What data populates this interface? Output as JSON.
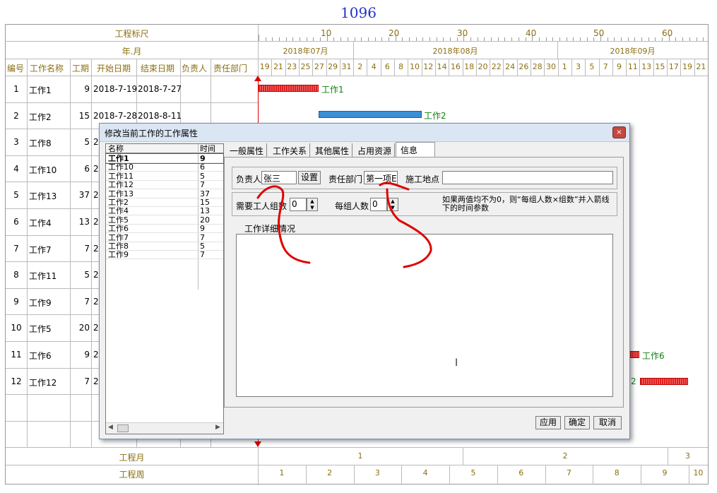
{
  "title": "1096",
  "header": {
    "ruler_label": "工程标尺",
    "month_label": "年.月",
    "ruler_ticks": [
      "10",
      "20",
      "30",
      "40",
      "50",
      "60"
    ],
    "months": [
      "2018年07月",
      "2018年08月",
      "2018年09月"
    ],
    "columns": {
      "no": "编号",
      "name": "工作名称",
      "duration": "工期",
      "start": "开始日期",
      "end": "结束日期",
      "owner": "负责人",
      "dept": "责任部门"
    },
    "days": [
      "19",
      "21",
      "23",
      "25",
      "27",
      "29",
      "31",
      "2",
      "4",
      "6",
      "8",
      "10",
      "12",
      "14",
      "16",
      "18",
      "20",
      "22",
      "24",
      "26",
      "28",
      "30",
      "1",
      "3",
      "5",
      "7",
      "9",
      "11",
      "13",
      "15",
      "17",
      "19",
      "21"
    ]
  },
  "rows": [
    {
      "no": "1",
      "name": "工作1",
      "dur": "9",
      "start": "2018-7-19",
      "end": "2018-7-27"
    },
    {
      "no": "2",
      "name": "工作2",
      "dur": "15",
      "start": "2018-7-28",
      "end": "2018-8-11"
    },
    {
      "no": "3",
      "name": "工作8",
      "dur": "5",
      "start": "2",
      "end": ""
    },
    {
      "no": "4",
      "name": "工作10",
      "dur": "6",
      "start": "2",
      "end": ""
    },
    {
      "no": "5",
      "name": "工作13",
      "dur": "37",
      "start": "2",
      "end": ""
    },
    {
      "no": "6",
      "name": "工作4",
      "dur": "13",
      "start": "2",
      "end": ""
    },
    {
      "no": "7",
      "name": "工作7",
      "dur": "7",
      "start": "2",
      "end": ""
    },
    {
      "no": "8",
      "name": "工作11",
      "dur": "5",
      "start": "2",
      "end": ""
    },
    {
      "no": "9",
      "name": "工作9",
      "dur": "7",
      "start": "2",
      "end": ""
    },
    {
      "no": "10",
      "name": "工作5",
      "dur": "20",
      "start": "2",
      "end": ""
    },
    {
      "no": "11",
      "name": "工作6",
      "dur": "9",
      "start": "2",
      "end": ""
    },
    {
      "no": "12",
      "name": "工作12",
      "dur": "7",
      "start": "2",
      "end": ""
    }
  ],
  "gantt_labels": {
    "r1": "工作1",
    "r2": "工作2",
    "r11": "工作6",
    "r12": "2"
  },
  "footer": {
    "month_label": "工程月",
    "week_label": "工程周",
    "months": [
      "1",
      "2",
      "3"
    ],
    "weeks": [
      "1",
      "2",
      "3",
      "4",
      "5",
      "6",
      "7",
      "8",
      "9",
      "10"
    ]
  },
  "dialog": {
    "title": "修改当前工作的工作属性",
    "close": "×",
    "list_headers": {
      "name": "名称",
      "time": "时间"
    },
    "list": [
      {
        "name": "工作1",
        "time": "9"
      },
      {
        "name": "工作10",
        "time": "6"
      },
      {
        "name": "工作11",
        "time": "5"
      },
      {
        "name": "工作12",
        "time": "7"
      },
      {
        "name": "工作13",
        "time": "37"
      },
      {
        "name": "工作2",
        "time": "15"
      },
      {
        "name": "工作4",
        "time": "13"
      },
      {
        "name": "工作5",
        "time": "20"
      },
      {
        "name": "工作6",
        "time": "9"
      },
      {
        "name": "工作7",
        "time": "7"
      },
      {
        "name": "工作8",
        "time": "5"
      },
      {
        "name": "工作9",
        "time": "7"
      }
    ],
    "tabs": [
      "一般属性",
      "工作关系",
      "其他属性",
      "占用资源",
      "信息"
    ],
    "owner_label": "负责人",
    "owner_value": "张三",
    "set_button": "设置",
    "dept_label": "责任部门",
    "dept_value": "第一项E",
    "site_label": "施工地点",
    "site_value": "",
    "groups_label": "需要工人组数",
    "groups_value": "0",
    "per_group_label": "每组人数",
    "per_group_value": "0",
    "note": "如果两值均不为0，则“每组人数×组数”并入箭线下的时间参数",
    "details_label": "工作详细情况",
    "apply": "应用",
    "ok": "确定",
    "cancel": "取消"
  },
  "colors": {
    "accent": "#2232c8",
    "header_text": "#8b6f14",
    "bar_red": "#e02020",
    "bar_blue": "#3a8fd8",
    "annotation": "#e00000"
  }
}
